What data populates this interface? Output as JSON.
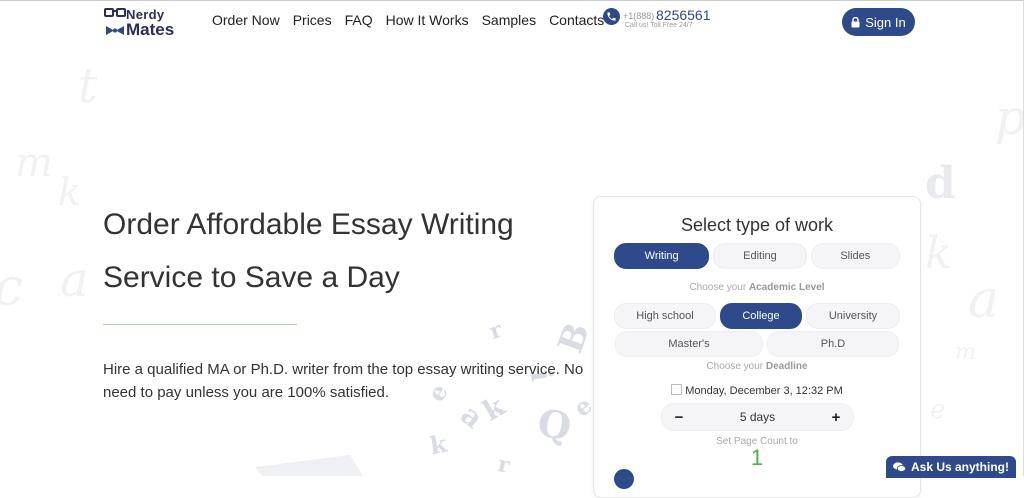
{
  "brand": {
    "name_line1": "Nerdy",
    "name_line2": "Mates"
  },
  "nav": {
    "items": [
      "Order Now",
      "Prices",
      "FAQ",
      "How It Works",
      "Samples",
      "Contacts"
    ]
  },
  "phone": {
    "prefix": "+1(888)",
    "number": "8256561",
    "subtitle": "Call us! Toll Free 24/7"
  },
  "signin_label": "Sign In",
  "hero": {
    "title": "Order Affordable Essay Writing Service to Save a Day",
    "text": "Hire a qualified MA or Ph.D. writer from the top essay writing service. No need to pay unless you are 100% satisfied."
  },
  "order_form": {
    "title": "Select type of work",
    "work_types": [
      "Writing",
      "Editing",
      "Slides"
    ],
    "work_type_selected": "Writing",
    "academic_level_hint_prefix": "Choose your",
    "academic_level_hint_bold": "Academic Level",
    "levels_row1": [
      "High school",
      "College",
      "University"
    ],
    "levels_row2": [
      "Master's",
      "Ph.D"
    ],
    "level_selected": "College",
    "deadline_hint_prefix": "Choose your",
    "deadline_hint_bold": "Deadline",
    "deadline_date": "Monday, December 3, 12:32 PM",
    "deadline_minus": "−",
    "deadline_value": "5 days",
    "deadline_plus": "+",
    "pages_label": "Set Page Count to",
    "pages_value": "1"
  },
  "chat_label": "Ask Us anything!",
  "colors": {
    "brand": "#2f4a8a",
    "logo_text": "#2b2d56",
    "accent_green": "#4caf50",
    "divider_green": "#a7d6a3"
  },
  "icons": [
    "glasses-logo-icon",
    "bowtie-icon",
    "phone-icon",
    "lock-icon",
    "calendar-icon",
    "chat-icon"
  ]
}
